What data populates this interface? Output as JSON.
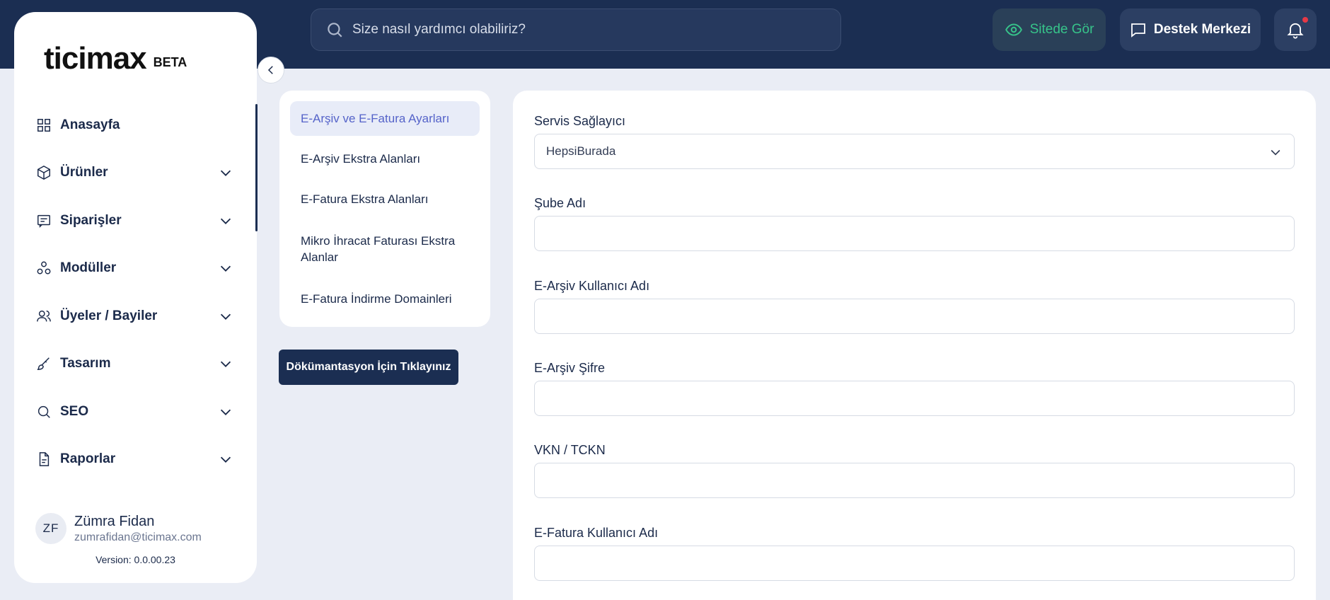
{
  "topbar": {
    "search_placeholder": "Size nasıl yardımcı olabiliriz?",
    "sitede_gor": "Sitede Gör",
    "destek_merkezi": "Destek Merkezi"
  },
  "brand": {
    "logo": "ticimax",
    "beta": "BETA"
  },
  "sidebar": {
    "items": [
      {
        "label": "Anasayfa",
        "icon": "grid-icon"
      },
      {
        "label": "Ürünler",
        "icon": "box-icon"
      },
      {
        "label": "Siparişler",
        "icon": "receipt-icon"
      },
      {
        "label": "Modüller",
        "icon": "modules-icon"
      },
      {
        "label": "Üyeler / Bayiler",
        "icon": "users-icon"
      },
      {
        "label": "Tasarım",
        "icon": "brush-icon"
      },
      {
        "label": "SEO",
        "icon": "search-icon"
      },
      {
        "label": "Raporlar",
        "icon": "document-icon"
      }
    ],
    "user": {
      "initials": "ZF",
      "name": "Zümra Fidan",
      "email": "zumrafidan@ticimax.com",
      "version": "Version: 0.0.00.23"
    }
  },
  "settings_tabs": [
    {
      "label": "E-Arşiv ve E-Fatura Ayarları",
      "active": true
    },
    {
      "label": "E-Arşiv Ekstra Alanları",
      "active": false
    },
    {
      "label": "E-Fatura Ekstra Alanları",
      "active": false
    },
    {
      "label": "Mikro İhracat Faturası Ekstra Alanlar",
      "active": false
    },
    {
      "label": "E-Fatura İndirme Domainleri",
      "active": false
    }
  ],
  "doc_button": "Dökümantasyon İçin Tıklayınız",
  "form": {
    "service_provider": {
      "label": "Servis Sağlayıcı",
      "value": "HepsiBurada"
    },
    "fields": [
      {
        "label": "Şube Adı",
        "value": ""
      },
      {
        "label": "E-Arşiv Kullanıcı Adı",
        "value": ""
      },
      {
        "label": "E-Arşiv Şifre",
        "value": ""
      },
      {
        "label": "VKN / TCKN",
        "value": ""
      },
      {
        "label": "E-Fatura Kullanıcı Adı",
        "value": ""
      }
    ]
  },
  "colors": {
    "topbar_bg": "#1b2e52",
    "page_bg": "#eaedf5",
    "accent_green": "#37c48a",
    "active_tab_text": "#5563c9",
    "notification_dot": "#e63946"
  }
}
